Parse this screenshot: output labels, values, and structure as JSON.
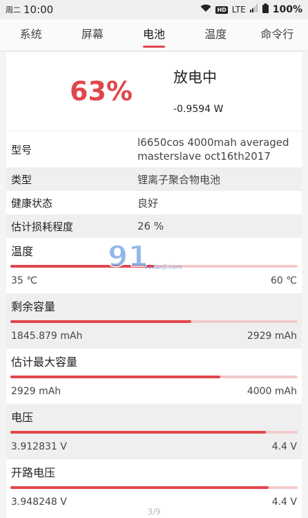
{
  "status_bar": {
    "weekday": "周二",
    "time": "10:00",
    "hd": "HD",
    "network": "LTE",
    "battery": "100%"
  },
  "tabs": [
    {
      "label": "系统"
    },
    {
      "label": "屏幕"
    },
    {
      "label": "电池"
    },
    {
      "label": "温度"
    },
    {
      "label": "命令行"
    }
  ],
  "hero": {
    "percent": "63%",
    "state": "放电中",
    "power": "-0.9594 W",
    "accent_color": "#e0474c"
  },
  "info": {
    "model": {
      "label": "型号",
      "value": "l6650cos 4000mah averaged masterslave oct16th2017"
    },
    "type": {
      "label": "类型",
      "value": "锂离子聚合物电池"
    },
    "health": {
      "label": "健康状态",
      "value": "良好"
    },
    "wear": {
      "label": "估计损耗程度",
      "value": "26 %"
    }
  },
  "meters": [
    {
      "title": "温度",
      "min": "35 ℃",
      "max": "60 ℃",
      "fill": 0.5
    },
    {
      "title": "剩余容量",
      "min": "1845.879 mAh",
      "max": "2929 mAh",
      "fill": 0.63
    },
    {
      "title": "估计最大容量",
      "min": "2929 mAh",
      "max": "4000 mAh",
      "fill": 0.73
    },
    {
      "title": "电压",
      "min": "3.912831 V",
      "max": "4.4 V",
      "fill": 0.89
    },
    {
      "title": "开路电压",
      "min": "3.948248 V",
      "max": "4.4 V",
      "fill": 0.9
    }
  ],
  "page_indicator": "3/9",
  "watermark": {
    "logo": "91",
    "text": "游戏",
    "site": "91danji.com"
  }
}
